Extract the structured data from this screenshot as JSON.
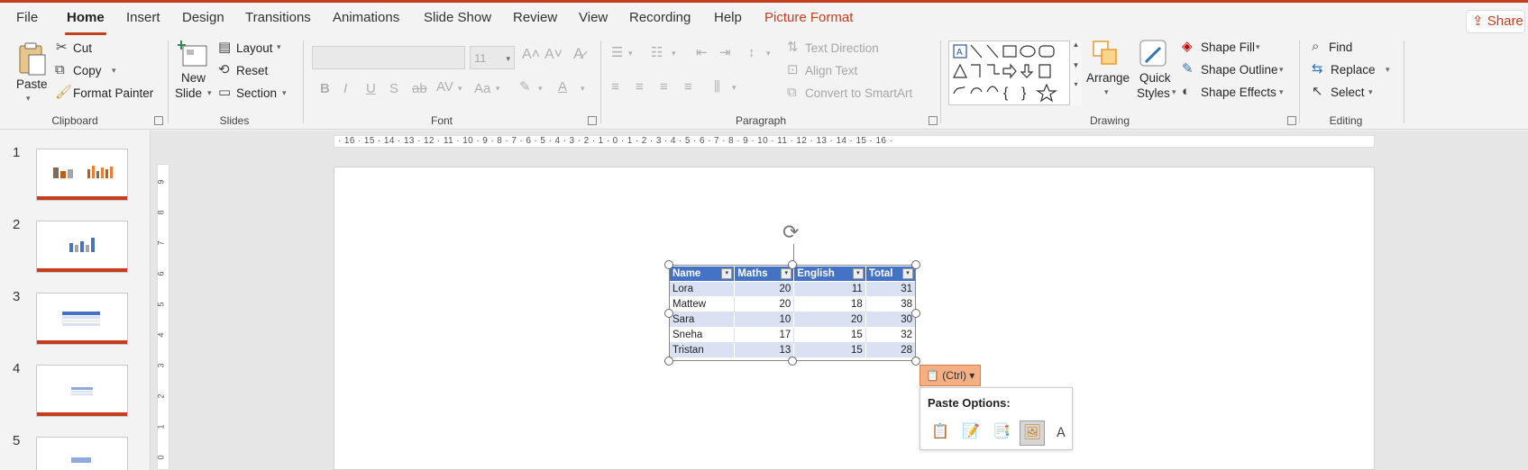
{
  "menu": {
    "tabs": [
      "File",
      "Home",
      "Insert",
      "Design",
      "Transitions",
      "Animations",
      "Slide Show",
      "Review",
      "View",
      "Recording",
      "Help",
      "Picture Format"
    ],
    "active": "Home",
    "share_label": "Share"
  },
  "ribbon": {
    "clipboard": {
      "paste": "Paste",
      "cut": "Cut",
      "copy": "Copy",
      "format_painter": "Format Painter",
      "label": "Clipboard"
    },
    "slides": {
      "new_slide_line1": "New",
      "new_slide_line2": "Slide",
      "layout": "Layout",
      "reset": "Reset",
      "section": "Section",
      "label": "Slides"
    },
    "font": {
      "font_size": "11",
      "label": "Font"
    },
    "paragraph": {
      "text_direction": "Text Direction",
      "align_text": "Align Text",
      "convert_smartart": "Convert to SmartArt",
      "label": "Paragraph"
    },
    "drawing": {
      "arrange": "Arrange",
      "quick_styles_1": "Quick",
      "quick_styles_2": "Styles",
      "shape_fill": "Shape Fill",
      "shape_outline": "Shape Outline",
      "shape_effects": "Shape Effects",
      "label": "Drawing"
    },
    "editing": {
      "find": "Find",
      "replace": "Replace",
      "select": "Select",
      "label": "Editing"
    }
  },
  "slides_pane": {
    "numbers": [
      "1",
      "2",
      "3",
      "4",
      "5"
    ]
  },
  "ruler": {
    "horizontal": "· 16 · 15 · 14 · 13 · 12 · 11 · 10 · 9 · 8 · 7 · 6 · 5 · 4 · 3 · 2 · 1 · 0 · 1 · 2 · 3 · 4 · 5 · 6 · 7 · 8 · 9 · 10 · 11 · 12 · 13 · 14 · 15 · 16 ·",
    "vertical": [
      "9",
      "8",
      "7",
      "6",
      "5",
      "4",
      "3",
      "2",
      "1",
      "0"
    ]
  },
  "table": {
    "headers": [
      "Name",
      "Maths",
      "English",
      "Total"
    ],
    "rows": [
      [
        "Lora",
        "20",
        "11",
        "31"
      ],
      [
        "Mattew",
        "20",
        "18",
        "38"
      ],
      [
        "Sara",
        "10",
        "20",
        "30"
      ],
      [
        "Sneha",
        "17",
        "15",
        "32"
      ],
      [
        "Tristan",
        "13",
        "15",
        "28"
      ]
    ]
  },
  "paste": {
    "ctrl_label": "(Ctrl)",
    "options_title": "Paste Options:",
    "options": [
      "keep-source-formatting-icon",
      "use-destination-styles-icon",
      "embed-icon",
      "picture-icon",
      "keep-text-only-icon"
    ]
  },
  "colors": {
    "accent": "#c43e1c",
    "table_header": "#4472c4",
    "table_band": "#d9e1f2",
    "ctrl_button": "#f4b084"
  }
}
